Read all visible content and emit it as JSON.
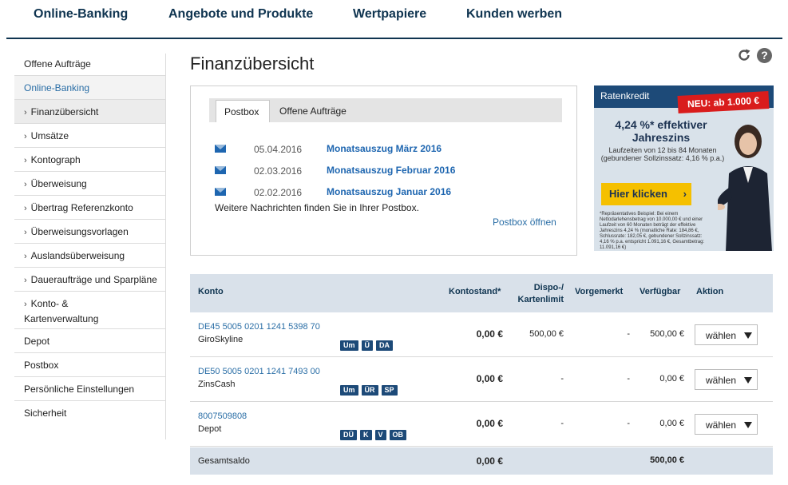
{
  "topnav": [
    "Online-Banking",
    "Angebote und Produkte",
    "Wertpapiere",
    "Kunden werben"
  ],
  "sidebar": {
    "items": [
      {
        "label": "Offene Aufträge"
      },
      {
        "label": "Online-Banking"
      },
      {
        "label": "Finanzübersicht"
      },
      {
        "label": "Umsätze"
      },
      {
        "label": "Kontograph"
      },
      {
        "label": "Überweisung"
      },
      {
        "label": "Übertrag Referenzkonto"
      },
      {
        "label": "Überweisungsvorlagen"
      },
      {
        "label": "Auslandsüberweisung"
      },
      {
        "label": "Daueraufträge und Sparpläne"
      },
      {
        "label": "Konto- &"
      },
      {
        "label": "Kartenverwaltung"
      },
      {
        "label": "Depot"
      },
      {
        "label": "Postbox"
      },
      {
        "label": "Persönliche Einstellungen"
      },
      {
        "label": "Sicherheit"
      }
    ],
    "subchevron": "›"
  },
  "page": {
    "title": "Finanzübersicht",
    "help_glyph": "?"
  },
  "postbox": {
    "tabs": [
      "Postbox",
      "Offene Aufträge"
    ],
    "messages": [
      {
        "date": "05.04.2016",
        "subject": "Monatsauszug März 2016"
      },
      {
        "date": "02.03.2016",
        "subject": "Monatsauszug Februar 2016"
      },
      {
        "date": "02.02.2016",
        "subject": "Monatsauszug Januar 2016"
      }
    ],
    "more_text": "Weitere Nachrichten finden Sie in Ihrer Postbox.",
    "open_link": "Postbox öffnen"
  },
  "ad": {
    "label": "Ratenkredit",
    "badge": "NEU: ab 1.000 €",
    "rate_line1": "4,24 %* effektiver",
    "rate_line2": "Jahreszins",
    "terms_line1": "Laufzeiten von 12 bis 84 Monaten",
    "terms_line2": "(gebundener Sollzinssatz: 4,16 % p.a.)",
    "button": "Hier klicken",
    "button_arrow": "›",
    "fine_print": "*Repräsentatives Beispiel: Bei einem Nettodarlehensbetrag von 10.000,00 € und einer Laufzeit von 60 Monaten beträgt der effektive Jahreszins 4,24 % (monatliche Rate: 184,86 €, Schlussrate: 182,05 €, gebundener Sollzinssatz: 4,16 % p.a. entspricht 1.091,16 €, Gesamtbetrag: 11.091,16 €)"
  },
  "table": {
    "headers": {
      "konto": "Konto",
      "kontostand": "Kontostand*",
      "dispo1": "Dispo-/",
      "dispo2": "Kartenlimit",
      "vorgemerkt": "Vorgemerkt",
      "verfuegbar": "Verfügbar",
      "aktion": "Aktion"
    },
    "rows": [
      {
        "iban": "DE45 5005 0201 1241 5398 70",
        "name": "GiroSkyline",
        "badges": [
          "Um",
          "Ü",
          "DA"
        ],
        "balance": "0,00 €",
        "dispo": "500,00 €",
        "vorgemerkt": "-",
        "verfuegbar": "500,00 €",
        "action": "wählen"
      },
      {
        "iban": "DE50 5005 0201 1241 7493 00",
        "name": "ZinsCash",
        "badges": [
          "Um",
          "ÜR",
          "SP"
        ],
        "balance": "0,00 €",
        "dispo": "-",
        "vorgemerkt": "-",
        "verfuegbar": "0,00 €",
        "action": "wählen"
      },
      {
        "iban": "8007509808",
        "name": "Depot",
        "badges": [
          "DÜ",
          "K",
          "V",
          "OB"
        ],
        "balance": "0,00 €",
        "dispo": "-",
        "vorgemerkt": "-",
        "verfuegbar": "0,00 €",
        "action": "wählen"
      }
    ],
    "total": {
      "label": "Gesamtsaldo",
      "balance": "0,00 €",
      "verfuegbar": "500,00 €"
    }
  },
  "colors": {
    "navy": "#0f3450",
    "link": "#2a6ea6",
    "table_header_bg": "#d9e1ea",
    "badge_bg": "#1d4a78",
    "ad_red": "#d91c1c",
    "ad_yellow": "#f5c000"
  }
}
